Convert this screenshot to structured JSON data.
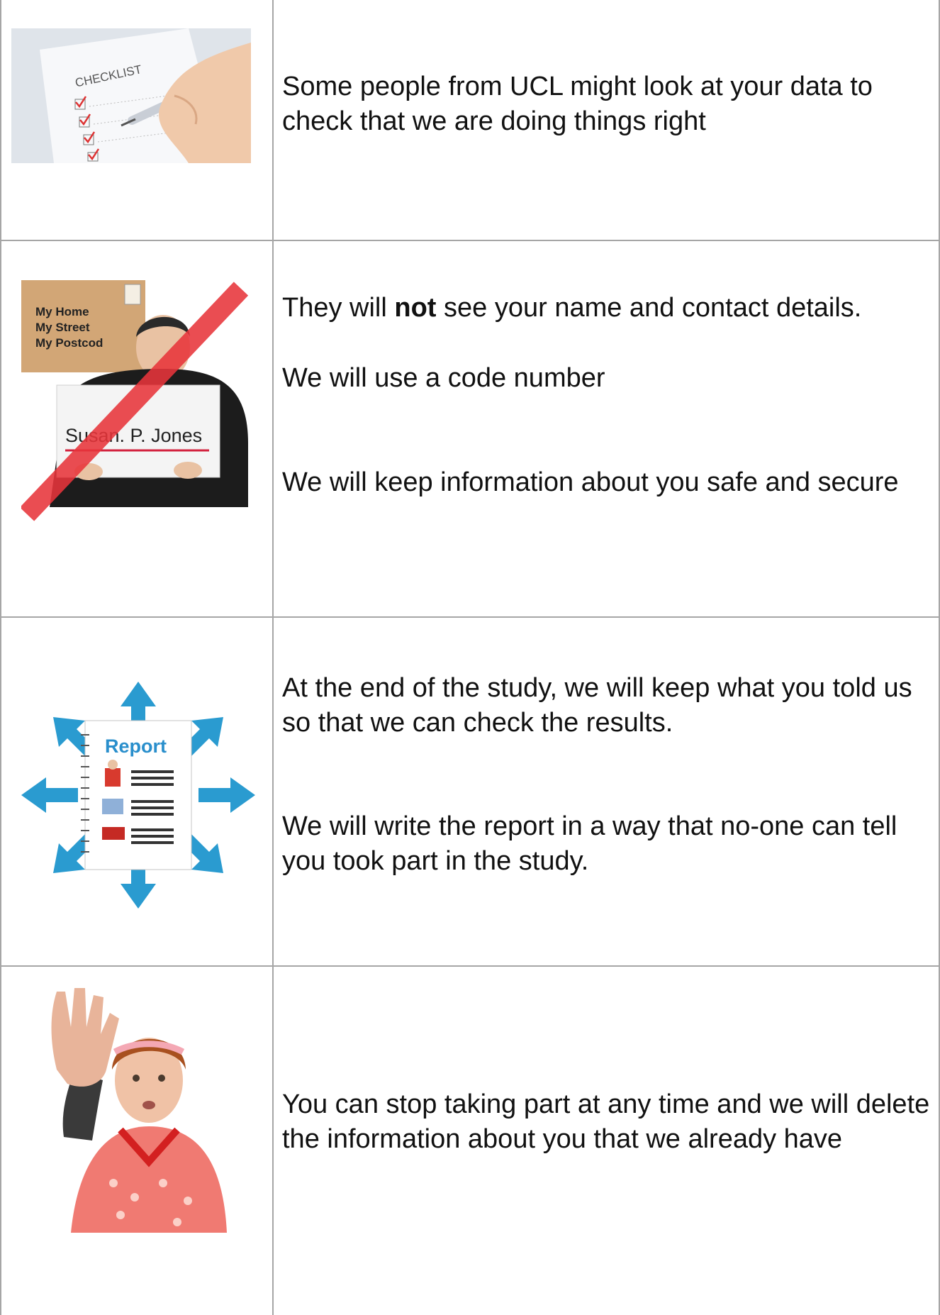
{
  "rows": [
    {
      "paragraphs": [
        "Some people from UCL might look at your data to check that we are doing things right"
      ],
      "picture": {
        "name": "checklist-picture",
        "label": "CHECKLIST"
      }
    },
    {
      "paragraph1": {
        "before": "They will ",
        "bold": "not",
        "after": " see your name and contact details."
      },
      "paragraphs": [
        "We will use a code number",
        "We will keep information about you safe and secure"
      ],
      "picture": {
        "name": "crossed-out-contact-details-picture",
        "address_lines": [
          "My Home",
          "My Street",
          "My Postcod"
        ],
        "name_card": "Susan. P. Jones"
      }
    },
    {
      "paragraphs": [
        "At the end of the study, we will keep what you told us so that we can check the results.",
        "We will write the report in a way that no-one can tell you took part in the study."
      ],
      "picture": {
        "name": "report-sharing-picture",
        "label": "Report"
      }
    },
    {
      "paragraphs": [
        "You can stop taking part at any time and we will delete the information about you that we already have"
      ],
      "picture": {
        "name": "stop-hand-picture"
      }
    }
  ],
  "colors": {
    "border": "#a6a6a6",
    "accent_red": "#e8353b",
    "arrow_blue": "#2a9bd0",
    "report_blue": "#2a8fcc"
  }
}
